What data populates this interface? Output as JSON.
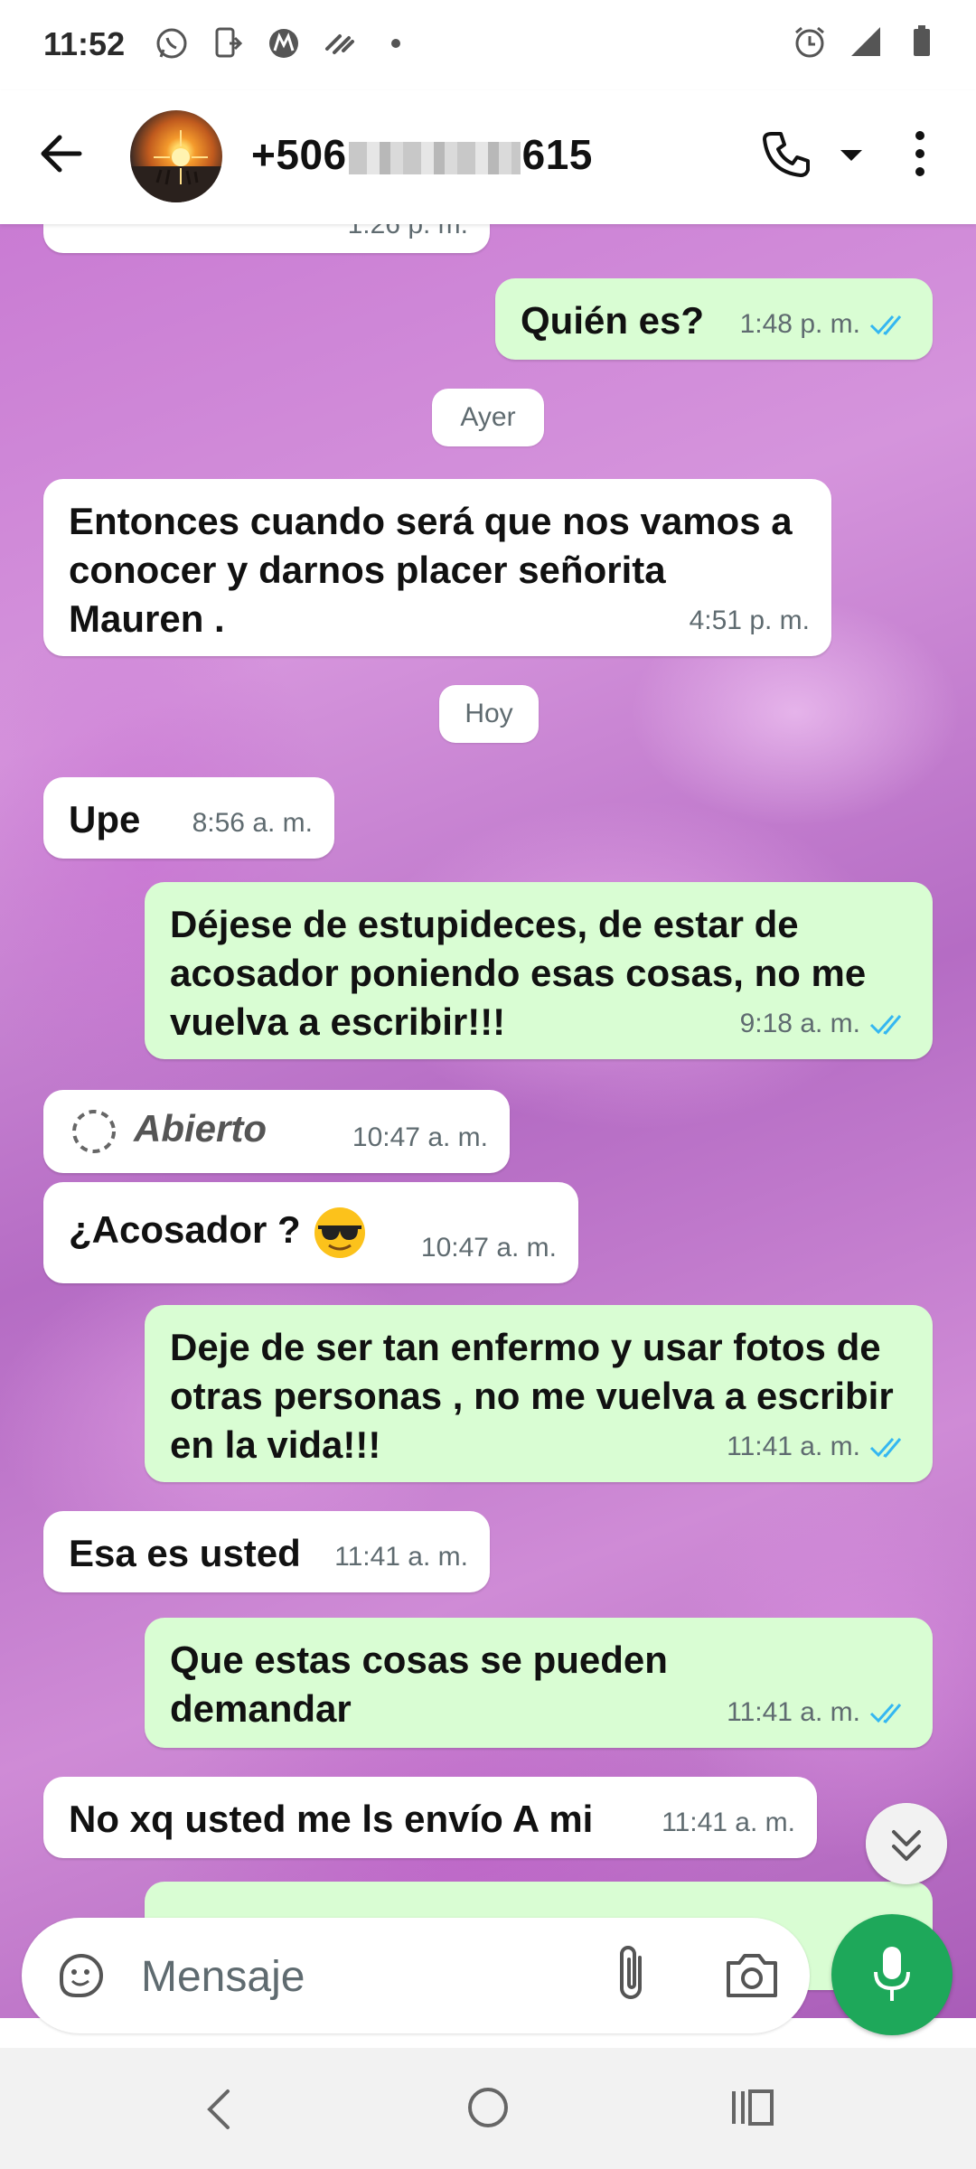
{
  "status_bar": {
    "time": "11:52",
    "left_icons": [
      "whatsapp-icon",
      "phone-transfer-icon",
      "motorola-icon",
      "swirl-icon",
      "dot-icon"
    ],
    "right_icons": [
      "alarm-icon",
      "signal-icon",
      "battery-icon"
    ]
  },
  "header": {
    "contact_prefix": "+506",
    "contact_suffix": "615",
    "icons": [
      "back-arrow-icon",
      "phone-icon",
      "caret-down-icon",
      "more-vert-icon"
    ]
  },
  "chat": {
    "partial_top_time": "1:26 p. m.",
    "messages": [
      {
        "dir": "out",
        "text": "Quién es?",
        "time": "1:48 p. m.",
        "ticks": true
      },
      {
        "dir": "date",
        "text": "Ayer"
      },
      {
        "dir": "in",
        "text": "Entonces cuando será que nos vamos a conocer y darnos placer señorita Mauren .",
        "time": "4:51 p. m."
      },
      {
        "dir": "date",
        "text": "Hoy"
      },
      {
        "dir": "in",
        "text": "Upe",
        "time": "8:56 a. m."
      },
      {
        "dir": "out",
        "text": "Déjese de estupideces, de estar de acosador poniendo esas cosas, no me vuelva a escribir!!!",
        "time": "9:18 a. m.",
        "ticks": true
      },
      {
        "dir": "in",
        "text": "Abierto",
        "time": "10:47 a. m.",
        "view_once": true
      },
      {
        "dir": "in",
        "text": "¿Acosador ?",
        "time": "10:47 a. m.",
        "emoji": "sunglasses-emoji"
      },
      {
        "dir": "out",
        "text": "Deje de ser tan enfermo  y usar fotos de otras personas , no me vuelva a escribir en la vida!!!",
        "time": "11:41 a. m.",
        "ticks": true
      },
      {
        "dir": "in",
        "text": "Esa es usted",
        "time": "11:41 a. m."
      },
      {
        "dir": "out",
        "text": "Que estas cosas se pueden demandar",
        "time": "11:41 a. m.",
        "ticks": true
      },
      {
        "dir": "in",
        "text": "No xq usted me ls envío A mi",
        "time": "11:41 a. m."
      }
    ]
  },
  "input": {
    "placeholder": "Mensaje"
  },
  "colors": {
    "outgoing_bubble": "#d9fdd3",
    "incoming_bubble": "#ffffff",
    "read_ticks": "#34b7f1",
    "mic_button": "#1ea85a"
  }
}
